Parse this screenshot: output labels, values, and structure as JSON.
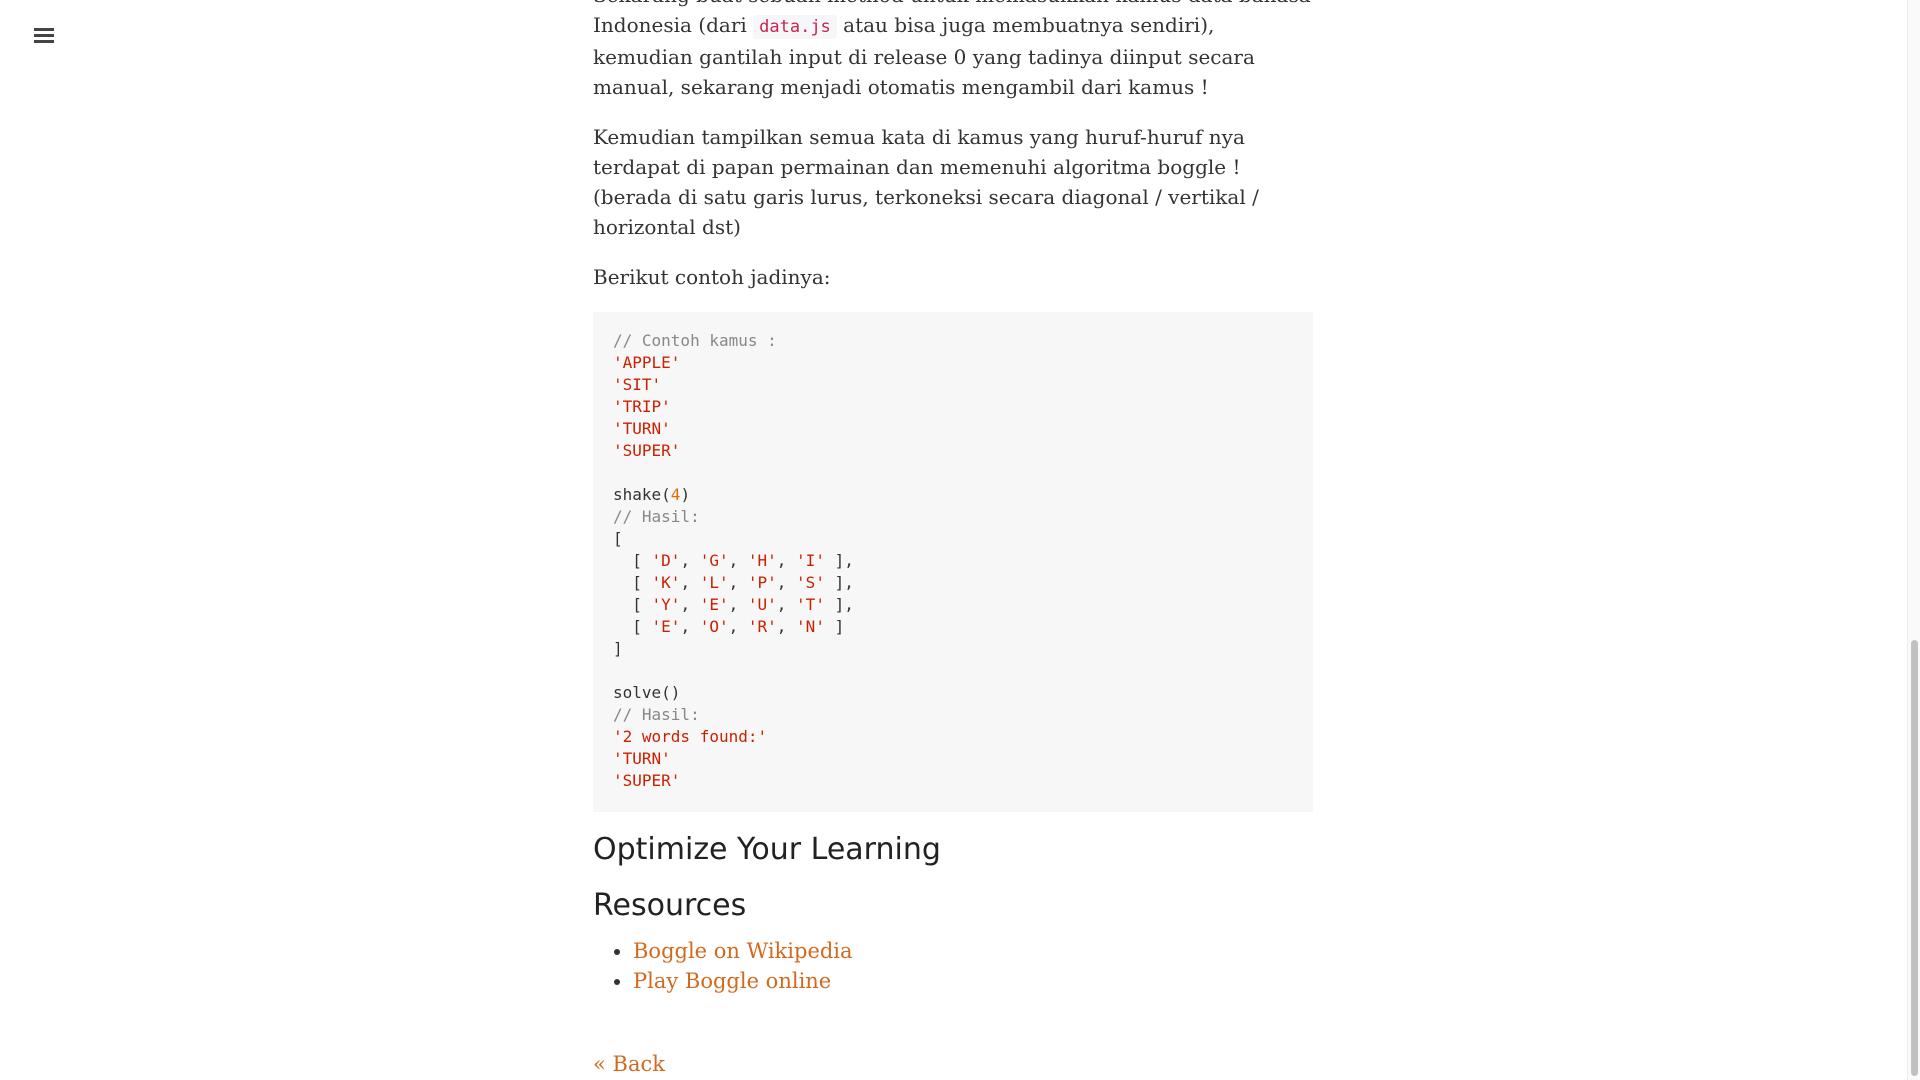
{
  "nav": {
    "menu_icon": "hamburger-menu-icon"
  },
  "paragraphs": {
    "p1_before": "Sekarang buat sebuah method untuk memasukkan kamus data bahasa Indonesia (dari ",
    "p1_code": "data.js",
    "p1_after": " atau bisa juga membuatnya sendiri), kemudian gantilah input di release 0 yang tadinya diinput secara manual, sekarang menjadi otomatis mengambil dari kamus !",
    "p2": "Kemudian tampilkan semua kata di kamus yang huruf-huruf nya terdapat di papan permainan dan memenuhi algoritma boggle ! (berada di satu garis lurus, terkoneksi secara diagonal / vertikal / horizontal dst)",
    "p3": "Berikut contoh jadinya:"
  },
  "code": {
    "comment_kamus": "// Contoh kamus :",
    "kamus": [
      "'APPLE'",
      "'SIT'",
      "'TRIP'",
      "'TURN'",
      "'SUPER'"
    ],
    "shake_fn": "shake(",
    "shake_arg": "4",
    "shake_close": ")",
    "comment_hasil": "// Hasil:",
    "open_bracket": "[",
    "close_bracket": "]",
    "board": [
      [
        "'D'",
        "'G'",
        "'H'",
        "'I'"
      ],
      [
        "'K'",
        "'L'",
        "'P'",
        "'S'"
      ],
      [
        "'Y'",
        "'E'",
        "'U'",
        "'T'"
      ],
      [
        "'E'",
        "'O'",
        "'R'",
        "'N'"
      ]
    ],
    "solve_call": "solve()",
    "comment_hasil2": "// Hasil:",
    "found": [
      "'2 words found:'",
      "'TURN'",
      "'SUPER'"
    ]
  },
  "headings": {
    "optimize": "Optimize Your Learning",
    "resources": "Resources"
  },
  "links": [
    {
      "label": "Boggle on Wikipedia"
    },
    {
      "label": "Play Boggle online"
    }
  ],
  "back_label": "« Back",
  "colors": {
    "link": "#d2691e",
    "code_string": "#cc1f00",
    "code_number": "#e06c00",
    "code_comment": "#888888",
    "code_bg": "#f7f7f7"
  }
}
